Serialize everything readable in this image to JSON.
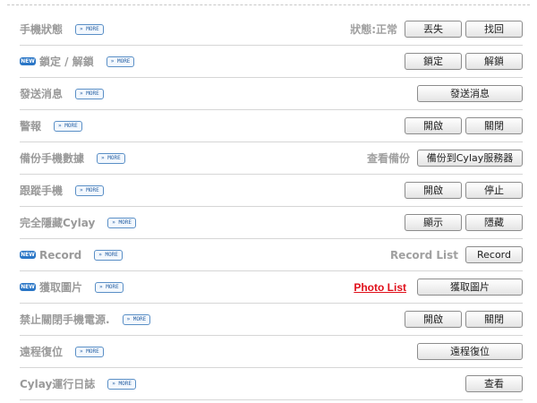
{
  "more_label": "» MORE",
  "new_badge": "NEW",
  "rows": [
    {
      "label": "手機狀態",
      "status": "狀態:正常",
      "buttons": [
        "丟失",
        "找回"
      ]
    },
    {
      "label": "鎖定 / 解鎖",
      "buttons": [
        "鎖定",
        "解鎖"
      ]
    },
    {
      "label": "發送消息",
      "buttons": [
        "發送消息"
      ]
    },
    {
      "label": "警報",
      "buttons": [
        "開啟",
        "關閉"
      ]
    },
    {
      "label": "備份手機數據",
      "status": "查看備份",
      "buttons": [
        "備份到Cylay服務器"
      ]
    },
    {
      "label": "跟蹤手機",
      "buttons": [
        "開啟",
        "停止"
      ]
    },
    {
      "label": "完全隱藏Cylay",
      "buttons": [
        "顯示",
        "隱藏"
      ]
    },
    {
      "label": "Record",
      "status": "Record List",
      "buttons": [
        "Record"
      ]
    },
    {
      "label": "獲取圖片",
      "link": "Photo List",
      "buttons": [
        "獲取圖片"
      ]
    },
    {
      "label": "禁止關閉手機電源.",
      "buttons": [
        "開啟",
        "關閉"
      ]
    },
    {
      "label": "遠程復位",
      "buttons": [
        "遠程復位"
      ]
    },
    {
      "label": "Cylay運行日誌",
      "buttons": [
        "查看"
      ]
    }
  ]
}
